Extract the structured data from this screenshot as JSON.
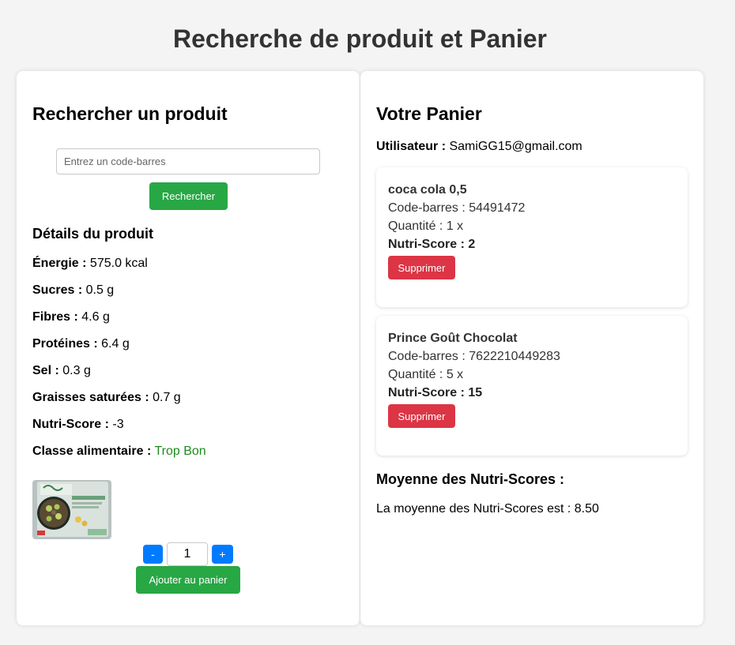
{
  "page": {
    "title": "Recherche de produit et Panier"
  },
  "search": {
    "heading": "Rechercher un produit",
    "placeholder": "Entrez un code-barres",
    "value": "",
    "button_label": "Rechercher"
  },
  "details": {
    "heading": "Détails du produit",
    "items": [
      {
        "label": "Énergie :",
        "value": "575.0 kcal"
      },
      {
        "label": "Sucres :",
        "value": "0.5 g"
      },
      {
        "label": "Fibres :",
        "value": "4.6 g"
      },
      {
        "label": "Protéines :",
        "value": "6.4 g"
      },
      {
        "label": "Sel :",
        "value": "0.3 g"
      },
      {
        "label": "Graisses saturées :",
        "value": "0.7 g"
      },
      {
        "label": "Nutri-Score :",
        "value": "-3"
      },
      {
        "label": "Classe alimentaire :",
        "value": "Trop Bon"
      }
    ],
    "class_color": "#1e8a1e",
    "quantity": {
      "minus_label": "-",
      "value": "1",
      "plus_label": "+"
    },
    "add_button_label": "Ajouter au panier"
  },
  "cart": {
    "heading": "Votre Panier",
    "user_label": "Utilisateur :",
    "user_email": "SamiGG15@gmail.com",
    "items": [
      {
        "name": "coca cola 0,5",
        "barcode": "Code-barres : 54491472",
        "quantity": "Quantité : 1 x",
        "nutriscore": "Nutri-Score : 2",
        "delete_label": "Supprimer"
      },
      {
        "name": "Prince Goût Chocolat",
        "barcode": "Code-barres : 7622210449283",
        "quantity": "Quantité : 5 x",
        "nutriscore": "Nutri-Score : 15",
        "delete_label": "Supprimer"
      }
    ],
    "average_heading": "Moyenne des Nutri-Scores :",
    "average_text": "La moyenne des Nutri-Scores est : 8.50"
  },
  "colors": {
    "primary_green": "#28a745",
    "danger_red": "#dc3545",
    "accent_blue": "#007bff",
    "background": "#f4f4f4"
  }
}
